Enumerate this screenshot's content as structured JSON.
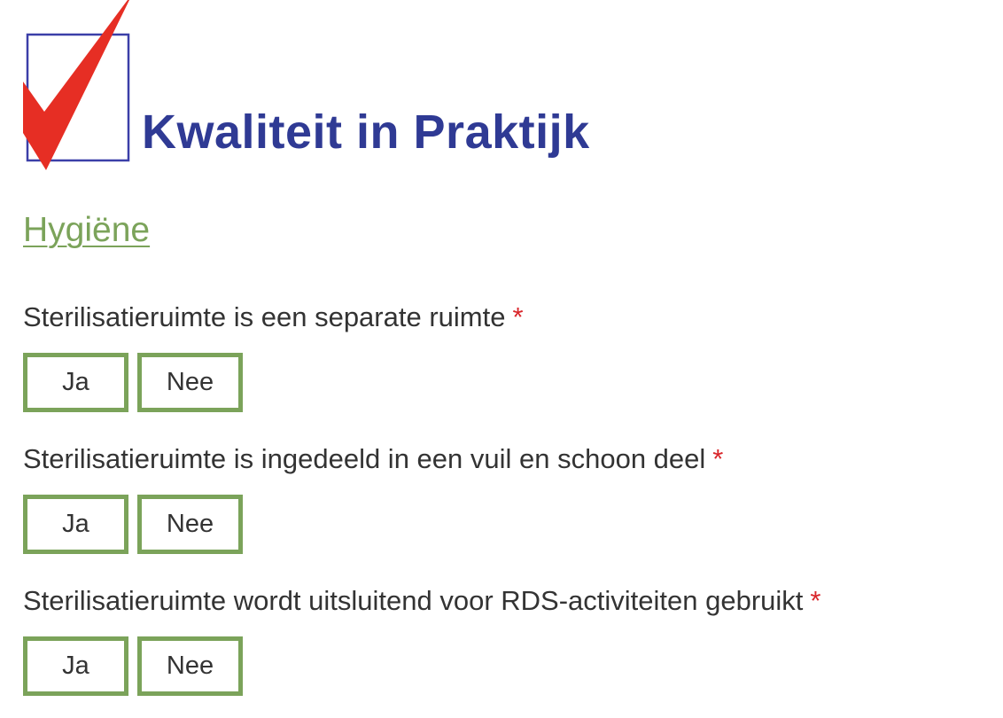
{
  "logo": {
    "text": "Kwaliteit in Praktijk",
    "icon": "check-in-box-icon",
    "colors": {
      "check": "#e62e24",
      "box": "#3b3fa8",
      "text": "#2f3a94"
    }
  },
  "section": {
    "title": "Hygiëne",
    "color": "#7ba35a"
  },
  "questions": [
    {
      "label": "Sterilisatieruimte is een separate ruimte",
      "required_mark": "*",
      "options": [
        "Ja",
        "Nee"
      ]
    },
    {
      "label": "Sterilisatieruimte is ingedeeld in een vuil en schoon deel",
      "required_mark": "*",
      "options": [
        "Ja",
        "Nee"
      ]
    },
    {
      "label": "Sterilisatieruimte wordt uitsluitend voor RDS-activiteiten gebruikt",
      "required_mark": "*",
      "options": [
        "Ja",
        "Nee"
      ]
    }
  ],
  "colors": {
    "option_border": "#7ba35a",
    "required": "#d9262b",
    "text": "#333333"
  }
}
